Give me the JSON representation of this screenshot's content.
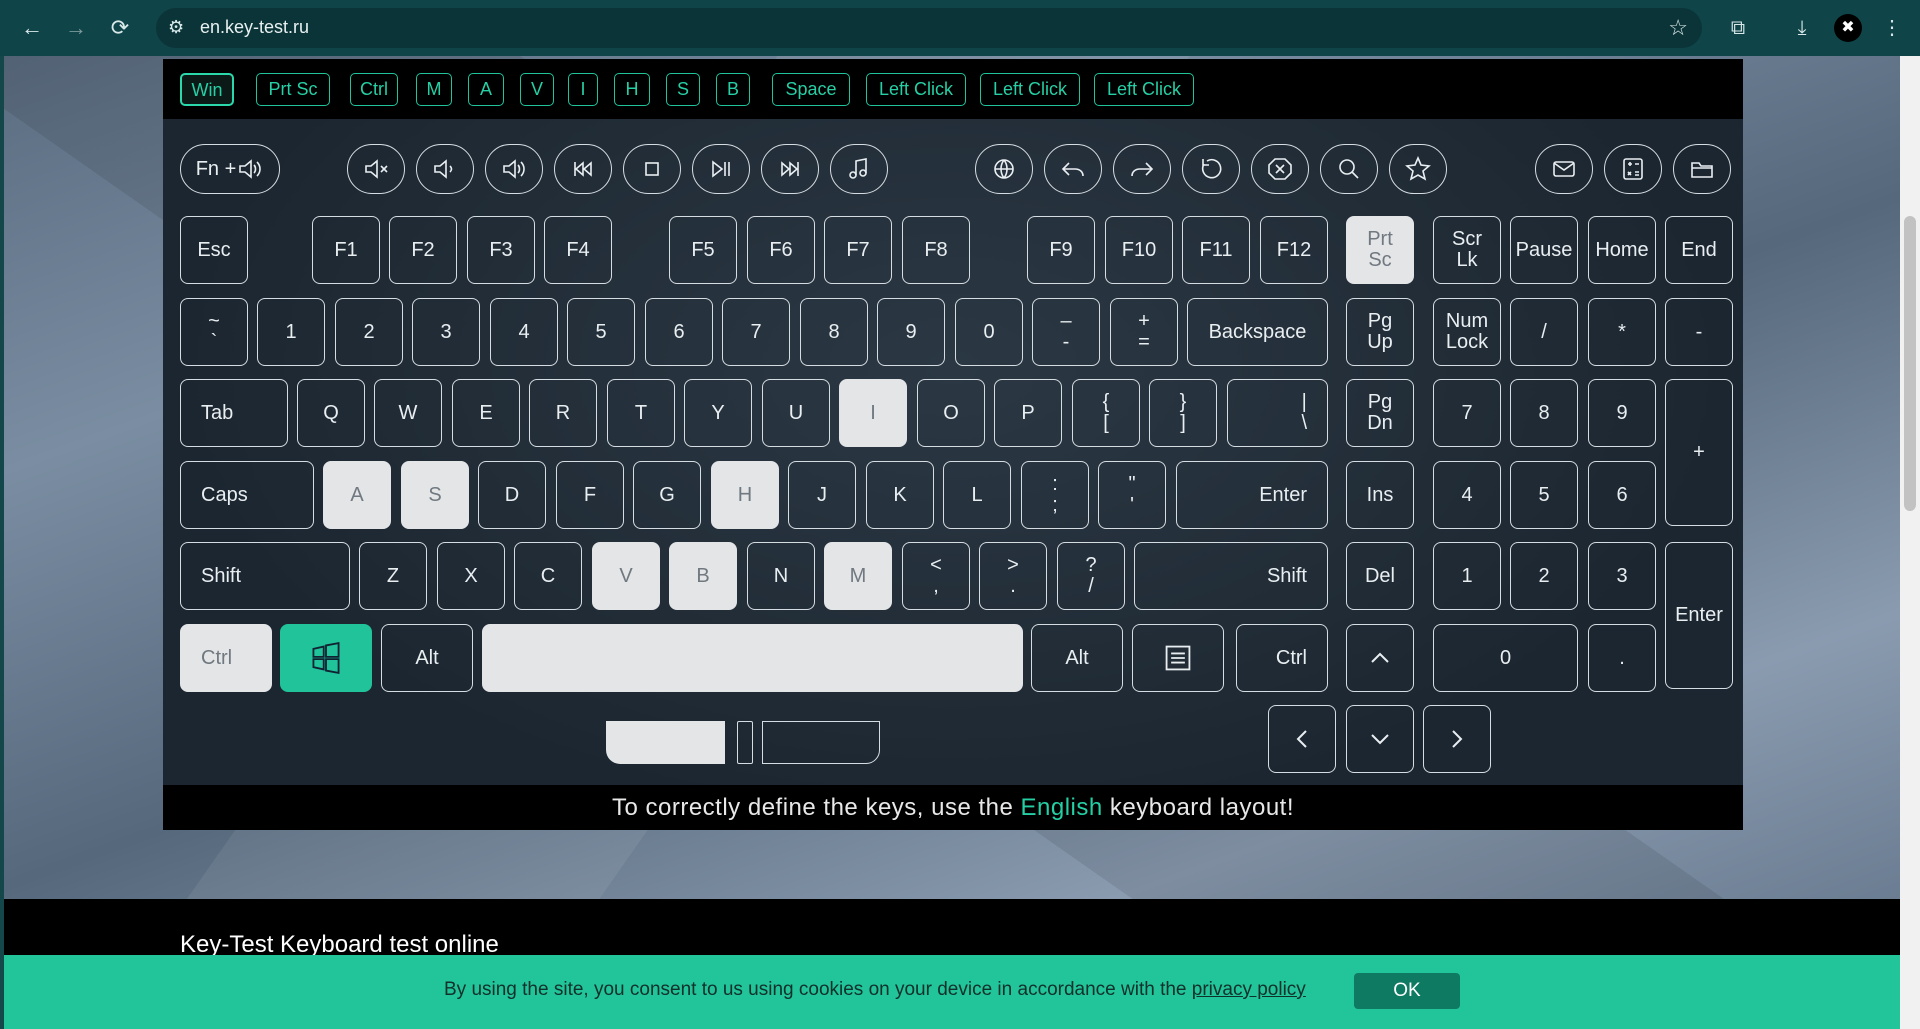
{
  "browser": {
    "url": "en.key-test.ru",
    "back": "←",
    "forward": "→",
    "reload": "⟳"
  },
  "history": [
    "Win",
    "Prt Sc",
    "Ctrl",
    "M",
    "A",
    "V",
    "I",
    "H",
    "S",
    "B",
    "Space",
    "Left Click",
    "Left Click",
    "Left Click"
  ],
  "media": {
    "fn": "Fn +"
  },
  "keys": {
    "esc": "Esc",
    "f1": "F1",
    "f2": "F2",
    "f3": "F3",
    "f4": "F4",
    "f5": "F5",
    "f6": "F6",
    "f7": "F7",
    "f8": "F8",
    "f9": "F9",
    "f10": "F10",
    "f11": "F11",
    "f12": "F12",
    "prtsc": "Prt\nSc",
    "scrlk": "Scr\nLk",
    "pause": "Pause",
    "home": "Home",
    "end": "End",
    "tilde": "~\n`",
    "n1": "1",
    "n2": "2",
    "n3": "3",
    "n4": "4",
    "n5": "5",
    "n6": "6",
    "n7": "7",
    "n8": "8",
    "n9": "9",
    "n0": "0",
    "minus": "–\n-",
    "plus": "+\n=",
    "backspace": "Backspace",
    "pgup": "Pg\nUp",
    "numlock": "Num\nLock",
    "npdiv": "/",
    "npmul": "*",
    "npminus": "-",
    "tab": "Tab",
    "q": "Q",
    "w": "W",
    "e": "E",
    "r": "R",
    "t": "T",
    "y": "Y",
    "u": "U",
    "i": "I",
    "o": "O",
    "p": "P",
    "lbr": "{\n[",
    "rbr": "}\n]",
    "bslash": "|\n\\",
    "pgdn": "Pg\nDn",
    "np7": "7",
    "np8": "8",
    "np9": "9",
    "npplus": "+",
    "caps": "Caps",
    "a": "A",
    "s": "S",
    "d": "D",
    "f": "F",
    "g": "G",
    "h": "H",
    "j": "J",
    "k": "K",
    "l": "L",
    "semi": ":\n;",
    "quote": "\"\n'",
    "enter": "Enter",
    "ins": "Ins",
    "np4": "4",
    "np5": "5",
    "np6": "6",
    "lshift": "Shift",
    "z": "Z",
    "x": "X",
    "c": "C",
    "v": "V",
    "b": "B",
    "n": "N",
    "m": "M",
    "comma": "<\n,",
    "period": ">\n.",
    "slash": "?\n/",
    "rshift": "Shift",
    "del": "Del",
    "np1": "1",
    "np2": "2",
    "np3": "3",
    "npenter": "Enter",
    "lctrl": "Ctrl",
    "lalt": "Alt",
    "ralt": "Alt",
    "rctrl": "Ctrl",
    "np0": "0",
    "npdot": "."
  },
  "notice": {
    "pre": "To correctly define the keys, use the ",
    "highlight": "English",
    "post": " keyboard layout!"
  },
  "footer": {
    "title": "Key-Test Keyboard test online"
  },
  "cookie": {
    "text": "By using the site, you consent to us using cookies on your device in accordance with the ",
    "link": "privacy policy",
    "ok": "OK"
  },
  "colors": {
    "accent": "#22c49a",
    "panel": "#1c2630",
    "pressed": "#e3e5e7"
  }
}
